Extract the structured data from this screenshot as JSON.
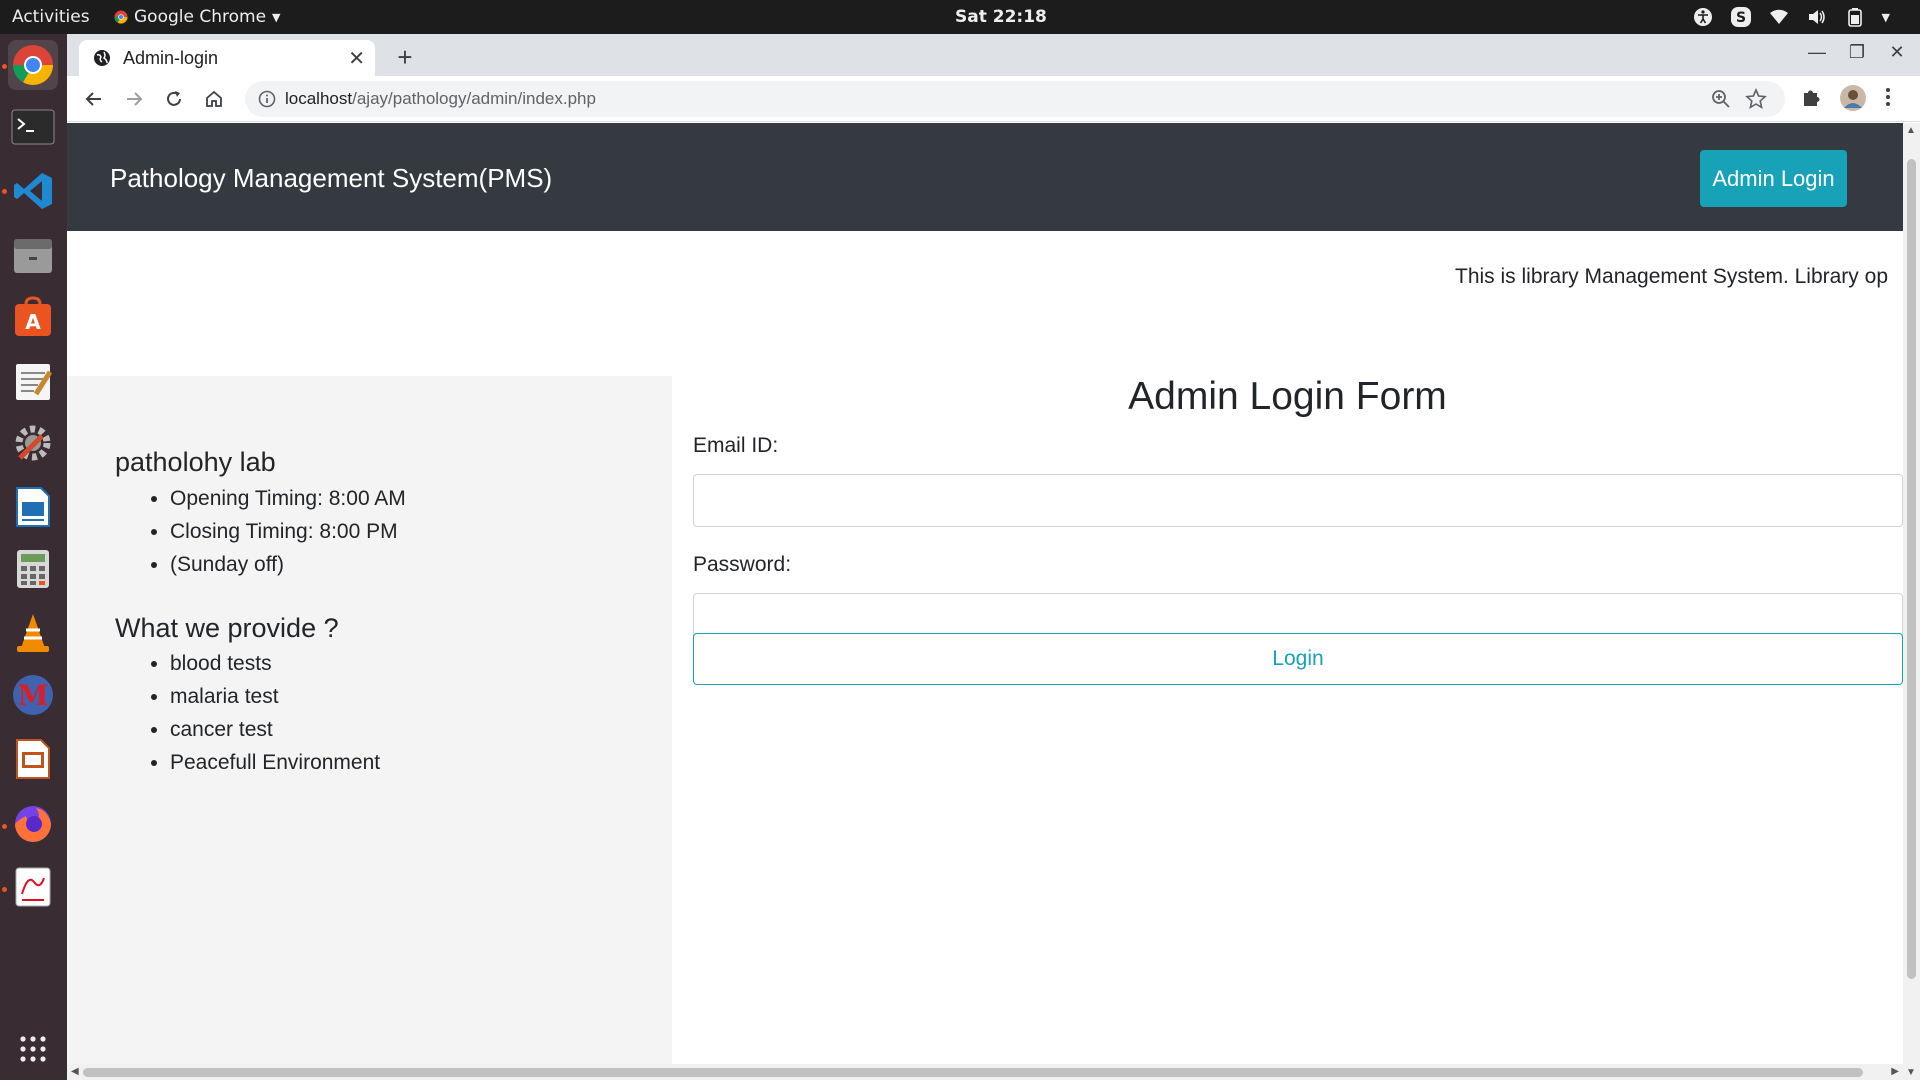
{
  "system": {
    "activities": "Activities",
    "app_name": "Google Chrome",
    "clock": "Sat 22:18"
  },
  "browser": {
    "tab_title": "Admin-login",
    "url_host": "localhost",
    "url_path": "/ajay/pathology/admin/index.php"
  },
  "page": {
    "brand": "Pathology Management System(PMS)",
    "admin_login_button": "Admin Login",
    "marquee_text": "This is library Management System. Library op",
    "sidebar": {
      "heading1": "patholohy lab",
      "timings": [
        "Opening Timing: 8:00 AM",
        "Closing Timing: 8:00 PM",
        "(Sunday off)"
      ],
      "heading2": "What we provide ?",
      "services": [
        "blood tests",
        "malaria test",
        "cancer test",
        "Peacefull Environment"
      ]
    },
    "form": {
      "title": "Admin Login Form",
      "email_label": "Email ID:",
      "email_value": "",
      "password_label": "Password:",
      "password_value": "",
      "submit_label": "Login"
    }
  },
  "colors": {
    "navbar": "#343a40",
    "accent": "#17a2b8",
    "sidebar_bg": "#f4f4f4"
  }
}
